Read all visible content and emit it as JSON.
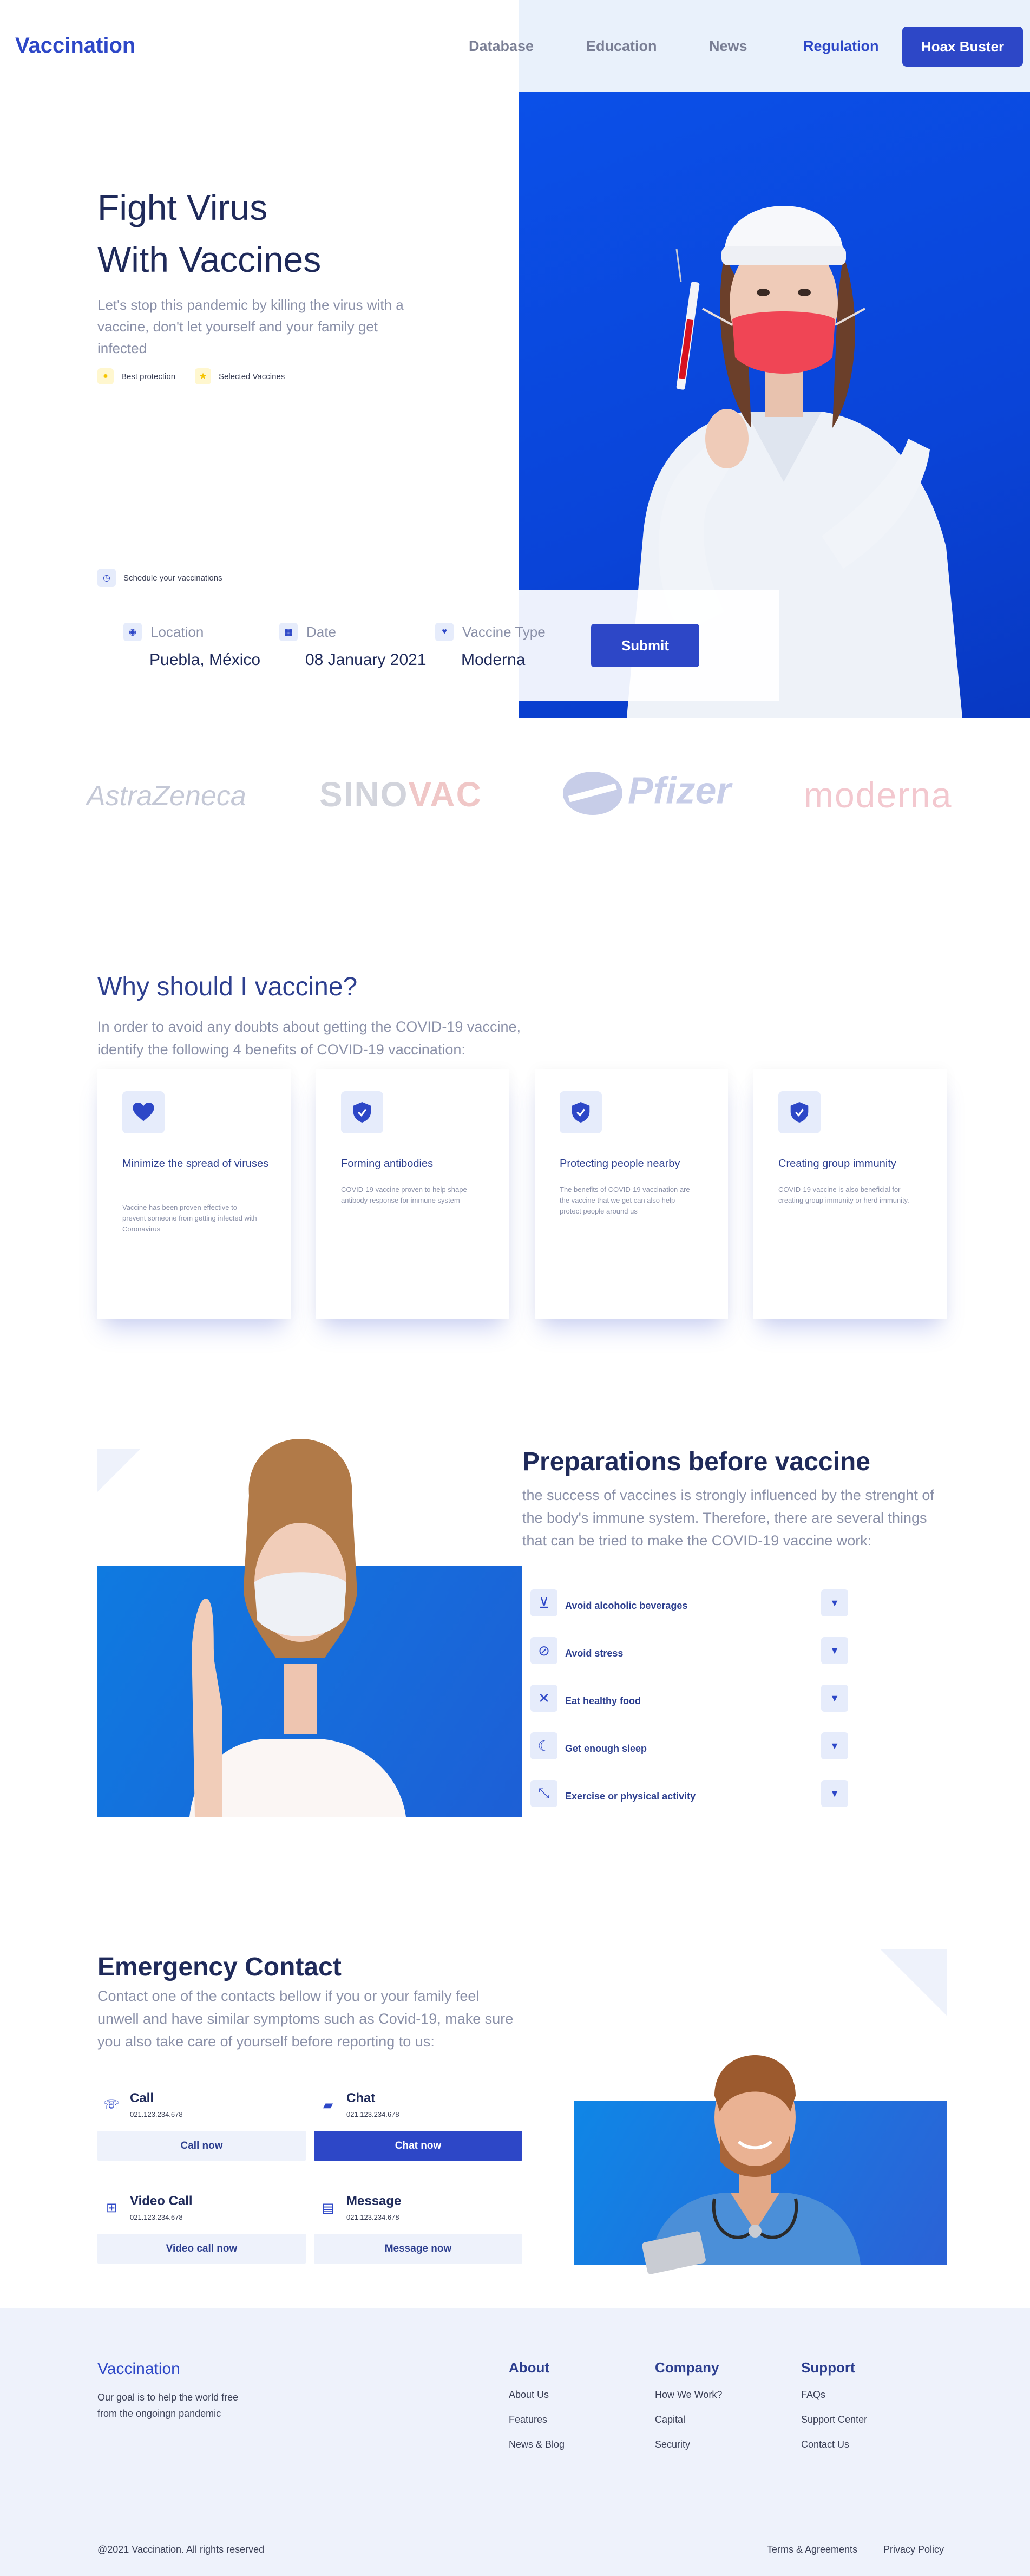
{
  "nav": {
    "brand": "Vaccination",
    "links": [
      "Database",
      "Education",
      "News",
      "Regulation"
    ],
    "active": "Regulation",
    "cta": "Hoax Buster"
  },
  "hero": {
    "title_line1": "Fight Virus",
    "title_line2": "With Vaccines",
    "subtitle": "Let's stop this pandemic by killing the virus with a vaccine, don't let yourself and your family get infected",
    "chips": [
      "Best protection",
      "Selected Vaccines"
    ],
    "schedule_label": "Schedule your vaccinations",
    "form": {
      "location_label": "Location",
      "location_value": "Puebla, México",
      "date_label": "Date",
      "date_value": "08 January 2021",
      "type_label": "Vaccine Type",
      "type_value": "Moderna",
      "submit_label": "Submit"
    }
  },
  "logos": {
    "astrazeneca": "AstraZeneca",
    "sinovac_a": "SINO",
    "sinovac_b": "VAC",
    "pfizer": "Pfizer",
    "moderna": "moderna"
  },
  "why": {
    "title": "Why should I vaccine?",
    "subtitle": "In order to avoid any doubts about getting the COVID-19 vaccine, identify the following 4 benefits of COVID-19 vaccination:",
    "cards": [
      {
        "title": "Minimize the spread of viruses",
        "desc": "Vaccine has been proven effective to prevent someone from getting infected with Coronavirus",
        "icon": "heart-icon"
      },
      {
        "title": "Forming antibodies",
        "desc": "COVID-19 vaccine proven to help shape antibody response for immune system",
        "icon": "shield-check-icon"
      },
      {
        "title": "Protecting people nearby",
        "desc": "The benefits of COVID-19 vaccination are the vaccine that we get can also help protect people around us",
        "icon": "shield-check-icon"
      },
      {
        "title": "Creating group immunity",
        "desc": "COVID-19 vaccine is also beneficial for creating group immunity or herd immunity.",
        "icon": "shield-check-icon"
      }
    ]
  },
  "prep": {
    "title": "Preparations before vaccine",
    "subtitle": "the success of vaccines is strongly influenced by the strenght of the body's immune system. Therefore, there are several things that can be tried to make the COVID-19 vaccine work:",
    "items": [
      {
        "label": "Avoid alcoholic beverages",
        "icon": "no-alcohol-icon"
      },
      {
        "label": "Avoid stress",
        "icon": "ban-icon"
      },
      {
        "label": "Eat healthy food",
        "icon": "utensils-icon"
      },
      {
        "label": "Get enough sleep",
        "icon": "moon-icon"
      },
      {
        "label": "Exercise or physical activity",
        "icon": "expand-arrows-icon"
      }
    ]
  },
  "emergency": {
    "title": "Emergency Contact",
    "subtitle": "Contact one of the contacts bellow if you or your family feel unwell and have similar symptoms such as Covid-19, make sure you also take care of yourself before reporting to us:",
    "contacts": [
      {
        "name": "Call",
        "phone": "021.123.234.678",
        "button": "Call now",
        "icon": "phone-icon"
      },
      {
        "name": "Chat",
        "phone": "021.123.234.678",
        "button": "Chat now",
        "icon": "chat-icon"
      },
      {
        "name": "Video Call",
        "phone": "021.123.234.678",
        "button": "Video call now",
        "icon": "video-call-icon"
      },
      {
        "name": "Message",
        "phone": "021.123.234.678",
        "button": "Message now",
        "icon": "message-icon"
      }
    ]
  },
  "footer": {
    "brand": "Vaccination",
    "description": "Our goal is to help the world free from the ongoingn pandemic",
    "columns": [
      {
        "title": "About",
        "links": [
          "About Us",
          "Features",
          "News & Blog"
        ]
      },
      {
        "title": "Company",
        "links": [
          "How We Work?",
          "Capital",
          "Security"
        ]
      },
      {
        "title": "Support",
        "links": [
          "FAQs",
          "Support Center",
          "Contact Us"
        ]
      }
    ],
    "copyright": "@2021 Vaccination. All rights reserved",
    "legal": [
      "Terms & Agreements",
      "Privacy Policy"
    ]
  },
  "colors": {
    "primary": "#2d47c7",
    "hero_blue": "#0a44d8",
    "navy_text": "#1f2a5a",
    "muted_text": "#8a90a8",
    "tint": "#eef2fb"
  }
}
